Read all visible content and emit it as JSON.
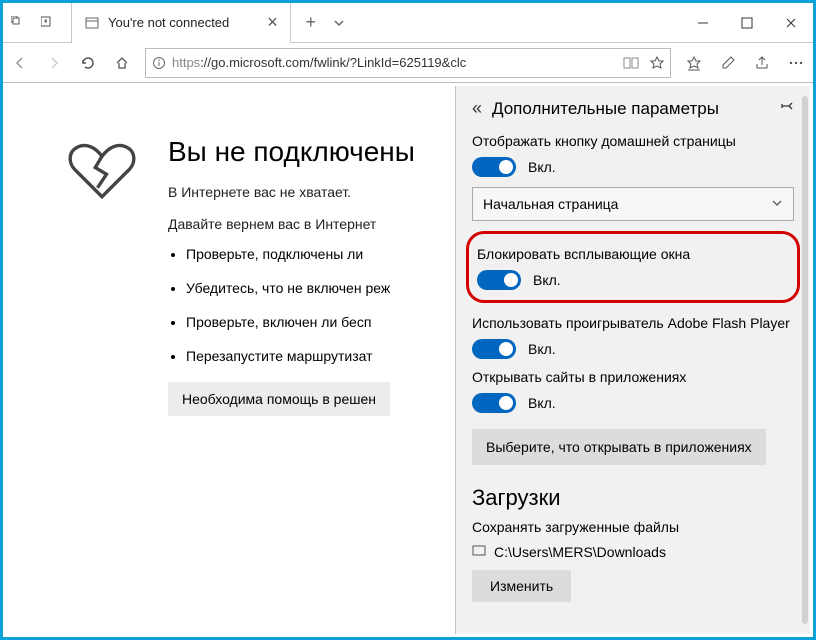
{
  "tab": {
    "title": "You're not connected"
  },
  "url": {
    "proto": "https",
    "rest": "://go.microsoft.com/fwlink/?LinkId=625119&clc"
  },
  "page": {
    "heading": "Вы не подключены",
    "sub1": "В Интернете вас не хватает.",
    "sub2": "Давайте вернем вас в Интернет",
    "bullets": [
      "Проверьте, подключены ли",
      "Убедитесь, что не включен реж",
      "Проверьте, включен ли бесп",
      "Перезапустите маршрутизат"
    ],
    "help_button": "Необходима помощь в решен"
  },
  "panel": {
    "title": "Дополнительные параметры",
    "home_button_label": "Отображать кнопку домашней страницы",
    "toggle_on": "Вкл.",
    "select_value": "Начальная страница",
    "popup_label": "Блокировать всплывающие окна",
    "flash_label": "Использовать проигрыватель Adobe Flash Player",
    "apps_label": "Открывать сайты в приложениях",
    "apps_button": "Выберите, что открывать в приложениях",
    "downloads_heading": "Загрузки",
    "downloads_sub": "Сохранять загруженные файлы",
    "downloads_path": "C:\\Users\\MERS\\Downloads",
    "change_button": "Изменить"
  }
}
